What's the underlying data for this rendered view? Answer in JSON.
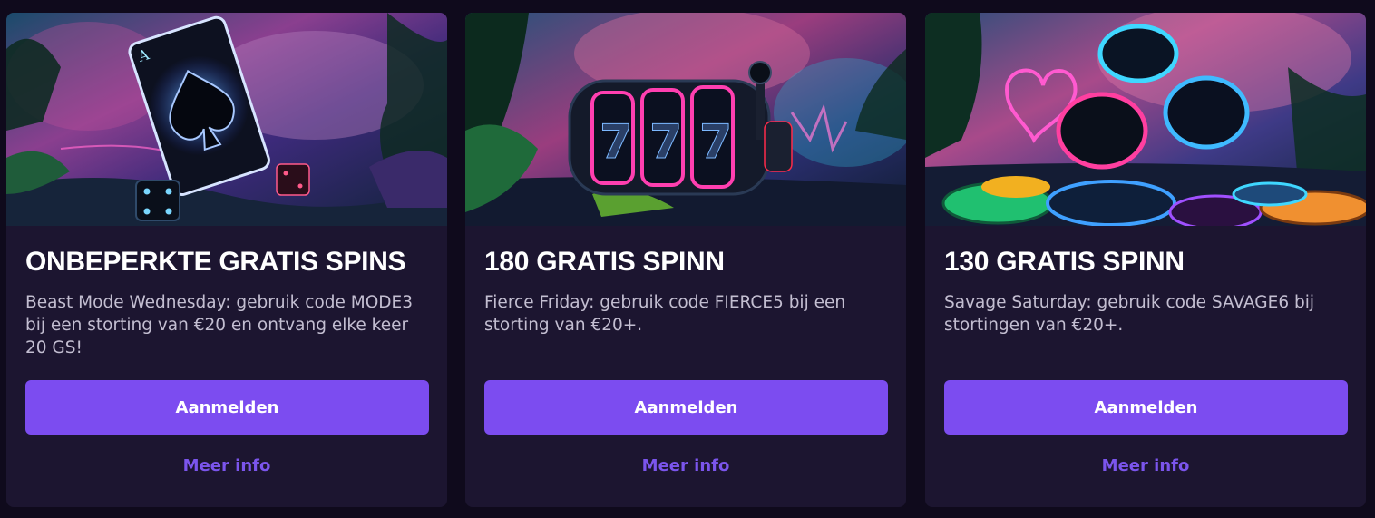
{
  "colors": {
    "page_bg": "#0f0a1c",
    "card_bg": "#1c1530",
    "accent": "#7c4cf0",
    "link": "#7b55ec"
  },
  "cards": [
    {
      "image_name": "spade-card-dice-jungle-illustration",
      "title": "ONBEPERKTE GRATIS SPINS",
      "description": "Beast Mode Wednesday: gebruik code MODE3 bij een storting van €20 en ontvang elke keer 20 GS!",
      "cta_label": "Aanmelden",
      "more_label": "Meer info"
    },
    {
      "image_name": "slot-machine-777-jungle-illustration",
      "title": "180 GRATIS SPINN",
      "description": "Fierce Friday: gebruik code FIERCE5 bij een storting van €20+.",
      "cta_label": "Aanmelden",
      "more_label": "Meer info"
    },
    {
      "image_name": "casino-chips-neon-heart-illustration",
      "title": "130 GRATIS SPINN",
      "description": "Savage Saturday: gebruik code SAVAGE6 bij stortingen van €20+.",
      "cta_label": "Aanmelden",
      "more_label": "Meer info"
    }
  ]
}
